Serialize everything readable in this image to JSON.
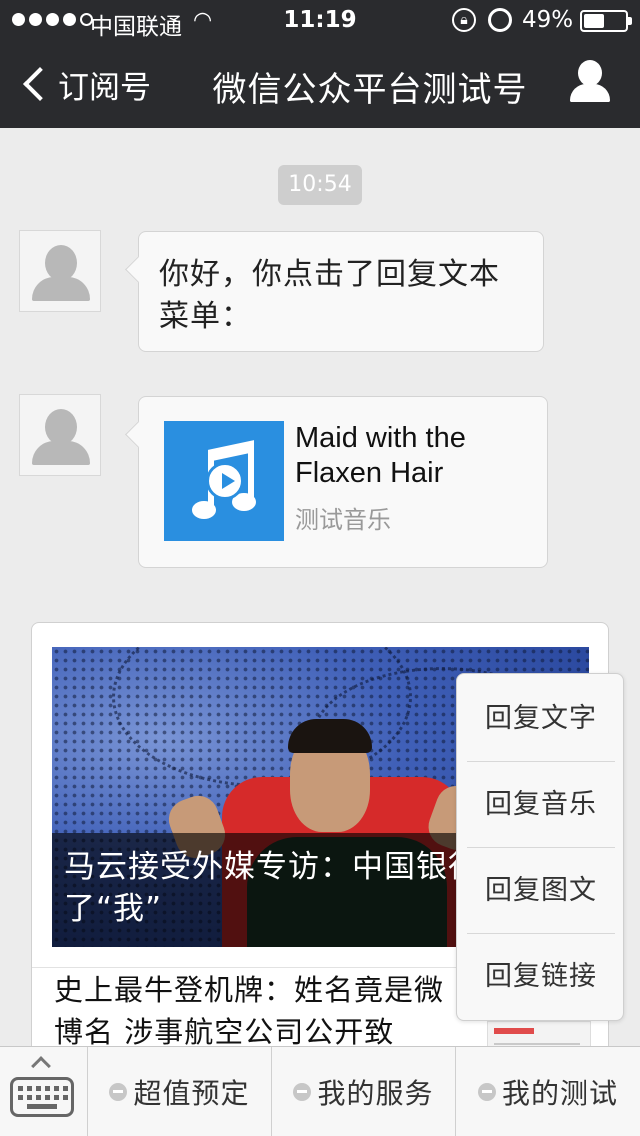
{
  "status_bar": {
    "carrier": "中国联通",
    "time": "11:19",
    "battery_percent": "49%",
    "battery_level": 0.49,
    "signal_dots_filled": 4,
    "signal_dots_total": 5,
    "icons": [
      "wifi-icon",
      "rotation-lock-icon",
      "alarm-icon",
      "battery-icon"
    ]
  },
  "nav": {
    "back_label": "订阅号",
    "title": "微信公众平台测试号",
    "profile_icon": "person-icon"
  },
  "chat": {
    "timestamp": "10:54",
    "messages": [
      {
        "type": "text",
        "text": "你好，你点击了回复文本菜单："
      },
      {
        "type": "music",
        "title": "Maid with the Flaxen Hair",
        "description": "测试音乐",
        "icon": "music-note-play-icon"
      }
    ],
    "news": {
      "main_caption": "马云接受外媒专访：中国银行想杀了“我”",
      "second_title": "史上最牛登机牌：姓名竟是微博名 涉事航空公司公开致"
    }
  },
  "popup_menu": {
    "items": [
      "回复文字",
      "回复音乐",
      "回复图文",
      "回复链接"
    ]
  },
  "bottom_menu": {
    "keyboard_icon": "keyboard-icon",
    "items": [
      "超值预定",
      "我的服务",
      "我的测试"
    ]
  },
  "colors": {
    "nav_background": "#2a2b2e",
    "chat_background": "#ececec",
    "music_art": "#2a8fe0"
  }
}
